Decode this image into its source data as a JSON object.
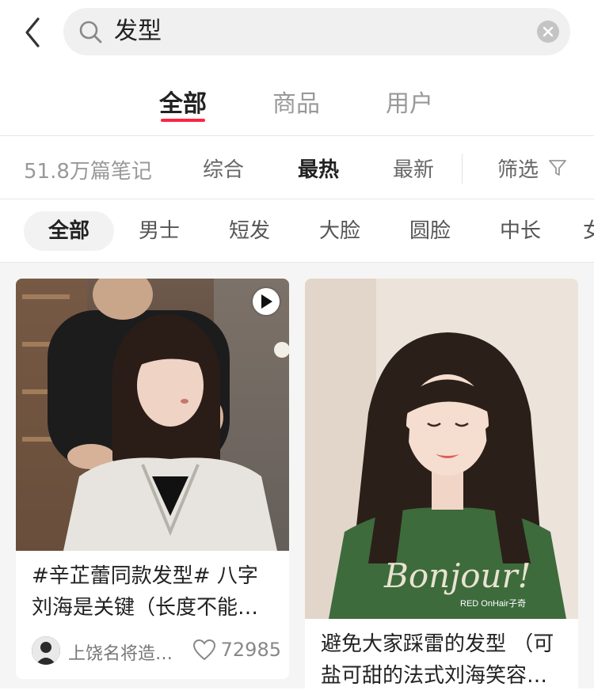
{
  "search": {
    "query": "发型"
  },
  "tabs": [
    {
      "label": "全部",
      "active": true
    },
    {
      "label": "商品",
      "active": false
    },
    {
      "label": "用户",
      "active": false
    }
  ],
  "sort": {
    "note_count": "51.8万篇笔记",
    "options": [
      {
        "label": "综合",
        "active": false
      },
      {
        "label": "最热",
        "active": true
      },
      {
        "label": "最新",
        "active": false
      }
    ],
    "filter_label": "筛选"
  },
  "chips": [
    {
      "label": "全部",
      "active": true
    },
    {
      "label": "男士",
      "active": false
    },
    {
      "label": "短发",
      "active": false
    },
    {
      "label": "大脸",
      "active": false
    },
    {
      "label": "圆脸",
      "active": false
    },
    {
      "label": "中长",
      "active": false
    },
    {
      "label": "女",
      "active": false
    }
  ],
  "cards": [
    {
      "title_line1": "#辛芷蕾同款发型# 八字",
      "title_line2": "刘海是关键（长度不能…",
      "author": "上饶名将造…",
      "likes": "72985",
      "is_video": true
    },
    {
      "title_line1": "避免大家踩雷的发型 （可",
      "title_line2": "盐可甜的法式刘海笑容…",
      "shirt_text": "Bonjour!",
      "watermark": "RED OnHair子奇",
      "is_video": false
    }
  ],
  "colors": {
    "accent": "#ff2442",
    "feed_bg": "#f5f5f5"
  }
}
